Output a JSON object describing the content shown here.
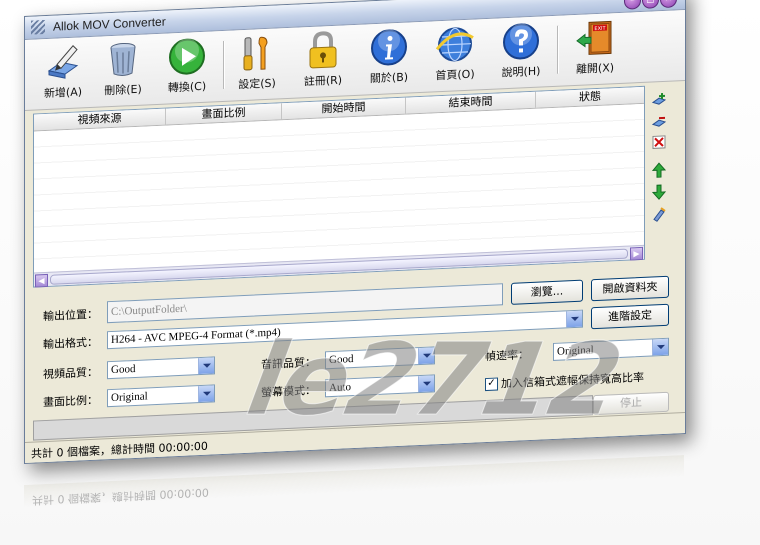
{
  "window": {
    "title": "Allok MOV Converter"
  },
  "toolbar": {
    "items": [
      {
        "name": "add",
        "label": "新增(A)",
        "icon": "add-pen-icon"
      },
      {
        "name": "delete",
        "label": "刪除(E)",
        "icon": "trash-can-icon"
      },
      {
        "name": "convert",
        "label": "轉換(C)",
        "icon": "play-icon"
      },
      {
        "name": "settings",
        "label": "設定(S)",
        "icon": "tools-icon"
      },
      {
        "name": "register",
        "label": "註冊(R)",
        "icon": "padlock-icon"
      },
      {
        "name": "about",
        "label": "關於(B)",
        "icon": "info-icon"
      },
      {
        "name": "homepage",
        "label": "首頁(O)",
        "icon": "globe-icon"
      },
      {
        "name": "help",
        "label": "說明(H)",
        "icon": "question-icon"
      },
      {
        "name": "exit",
        "label": "離開(X)",
        "icon": "exit-door-icon"
      }
    ]
  },
  "list": {
    "columns": [
      "視頻來源",
      "畫面比例",
      "開始時間",
      "結束時間",
      "狀態"
    ]
  },
  "form": {
    "output_location_label": "輸出位置：",
    "output_location_value": "C:\\OutputFolder\\",
    "browse_label": "瀏覽...",
    "open_folder_label": "開啟資料夾",
    "output_format_label": "輸出格式：",
    "output_format_value": "H264 - AVC MPEG-4 Format (*.mp4)",
    "advanced_label": "進階設定",
    "video_quality_label": "視頻品質：",
    "video_quality_value": "Good",
    "audio_quality_label": "音訊品質：",
    "audio_quality_value": "Good",
    "frame_rate_label": "幀速率：",
    "frame_rate_value": "Original",
    "aspect_ratio_label": "畫面比例：",
    "aspect_ratio_value": "Original",
    "screen_mode_label": "螢幕模式：",
    "screen_mode_value": "Auto",
    "keep_aspect_label": "加入信箱式遮幅保持寬高比率",
    "keep_aspect_checked": true,
    "stop_label": "停止"
  },
  "status": {
    "text": "共計 0 個檔案，總計時間 00:00:00"
  },
  "watermark": {
    "text": "le2712"
  },
  "colors": {
    "accent": "#7f9db9",
    "titlebar": "#c7d4ea",
    "dialog_bg": "#ece9d8"
  }
}
